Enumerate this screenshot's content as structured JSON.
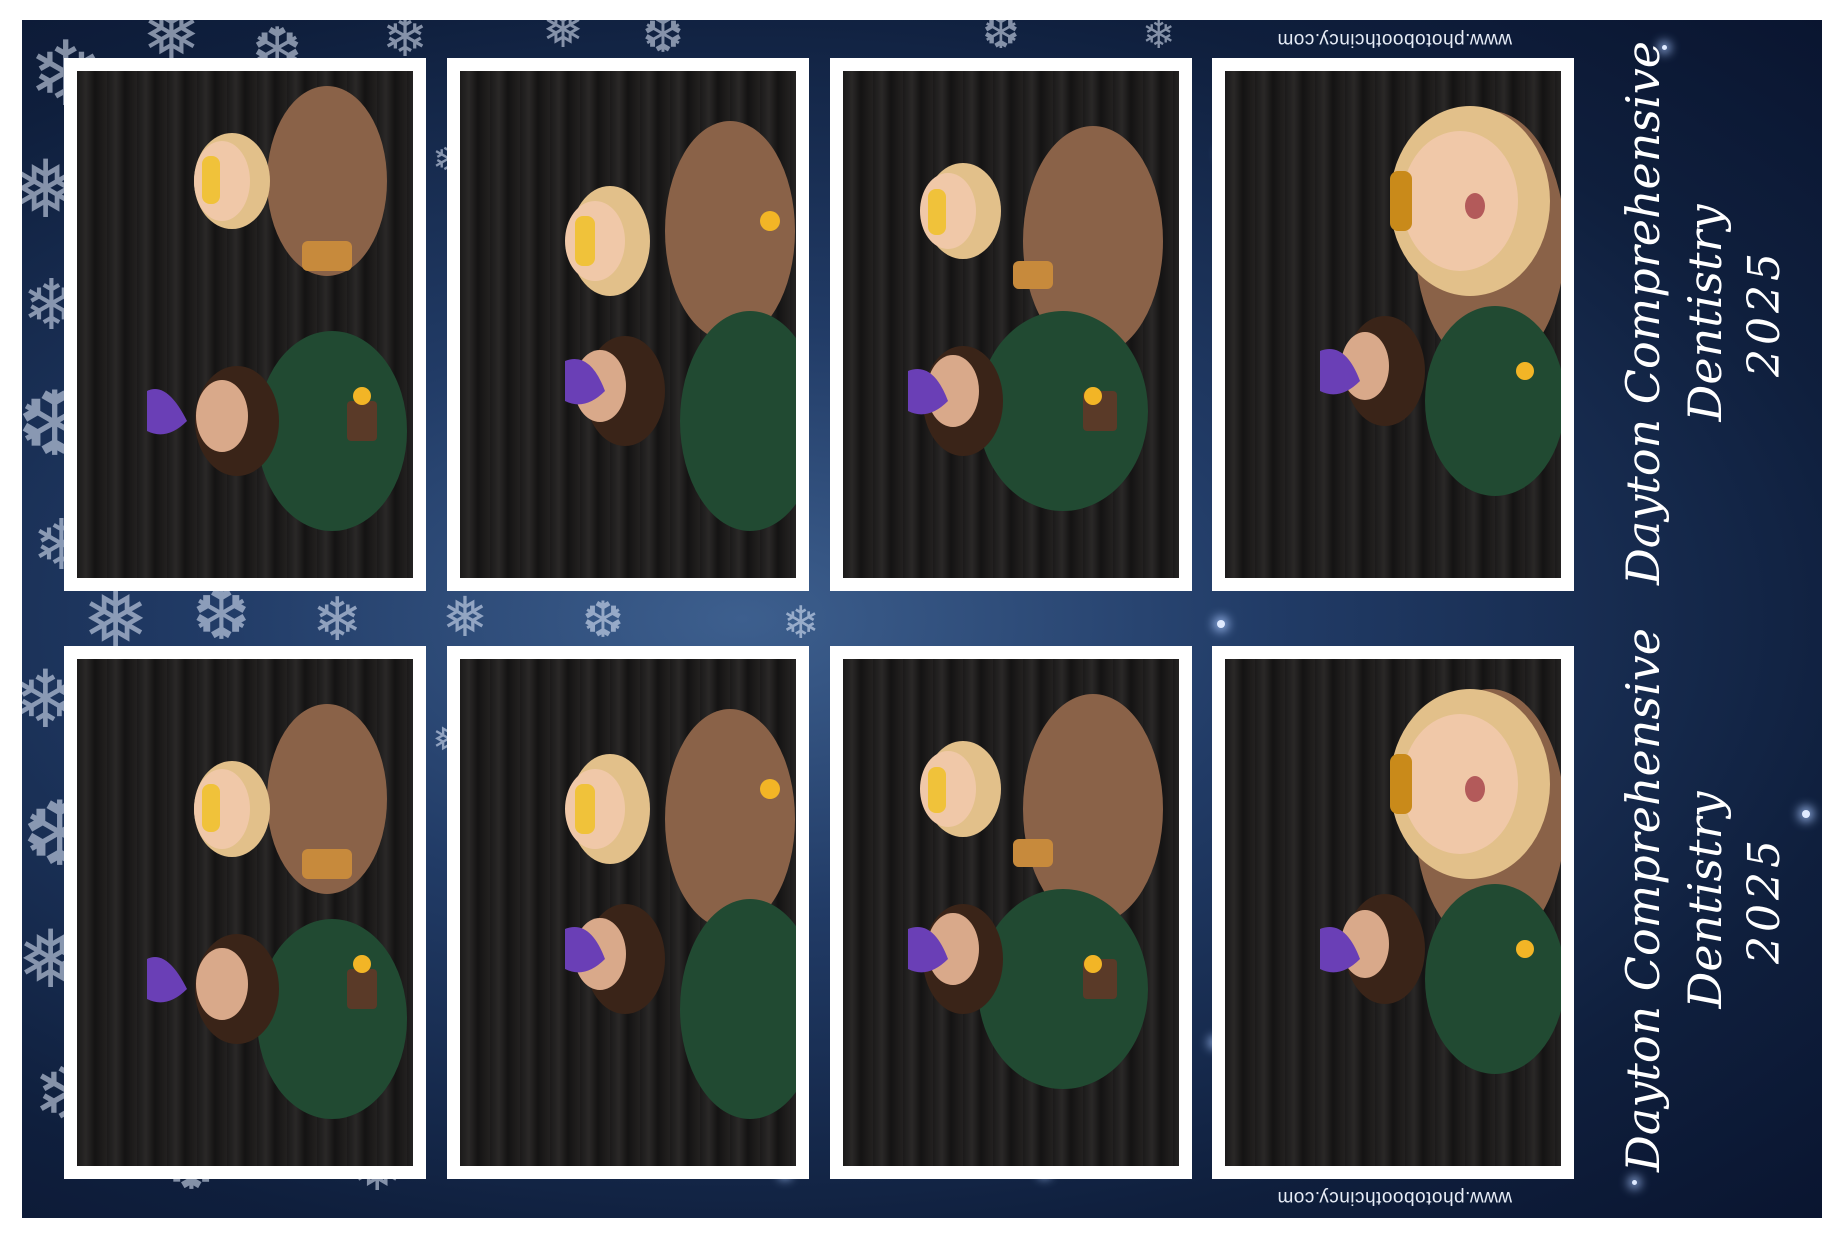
{
  "website": "www.photoboothcincy.com",
  "event": {
    "line1": "Dayton Comprehensive",
    "line2": "Dentistry",
    "year": "2025"
  },
  "colors": {
    "background_dark": "#0f1f3d",
    "background_light": "#3d5f8e",
    "frame": "#ffffff",
    "text": "#ffffff"
  },
  "strips": [
    {
      "name": "top-strip"
    },
    {
      "name": "bottom-strip"
    }
  ]
}
